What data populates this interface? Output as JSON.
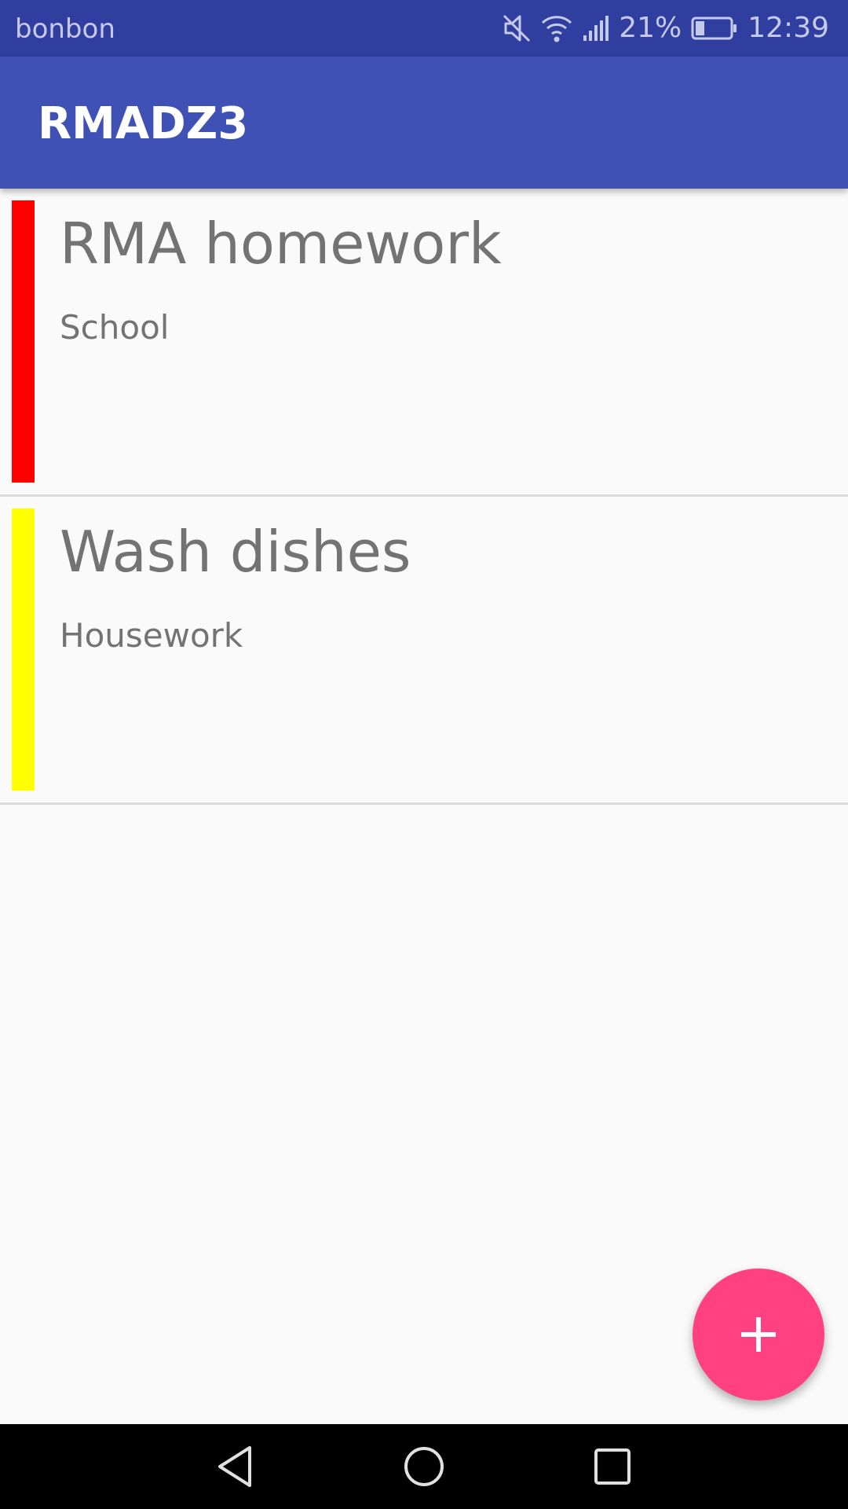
{
  "status_bar": {
    "carrier": "bonbon",
    "battery_percent": "21%",
    "time": "12:39",
    "icons": [
      "mute-icon",
      "wifi-icon",
      "signal-icon",
      "battery-icon"
    ]
  },
  "app_bar": {
    "title": "RMADZ3"
  },
  "tasks": [
    {
      "title": "RMA homework",
      "category": "School",
      "color": "#ff0000"
    },
    {
      "title": "Wash dishes",
      "category": "Housework",
      "color": "#ffff00"
    }
  ],
  "fab": {
    "icon": "plus-icon",
    "color": "#ff4081"
  },
  "nav_bar": {
    "buttons": [
      "back-icon",
      "home-icon",
      "recents-icon"
    ]
  },
  "colors": {
    "primary": "#3f51b5",
    "primary_dark": "#303f9f",
    "accent": "#ff4081"
  }
}
